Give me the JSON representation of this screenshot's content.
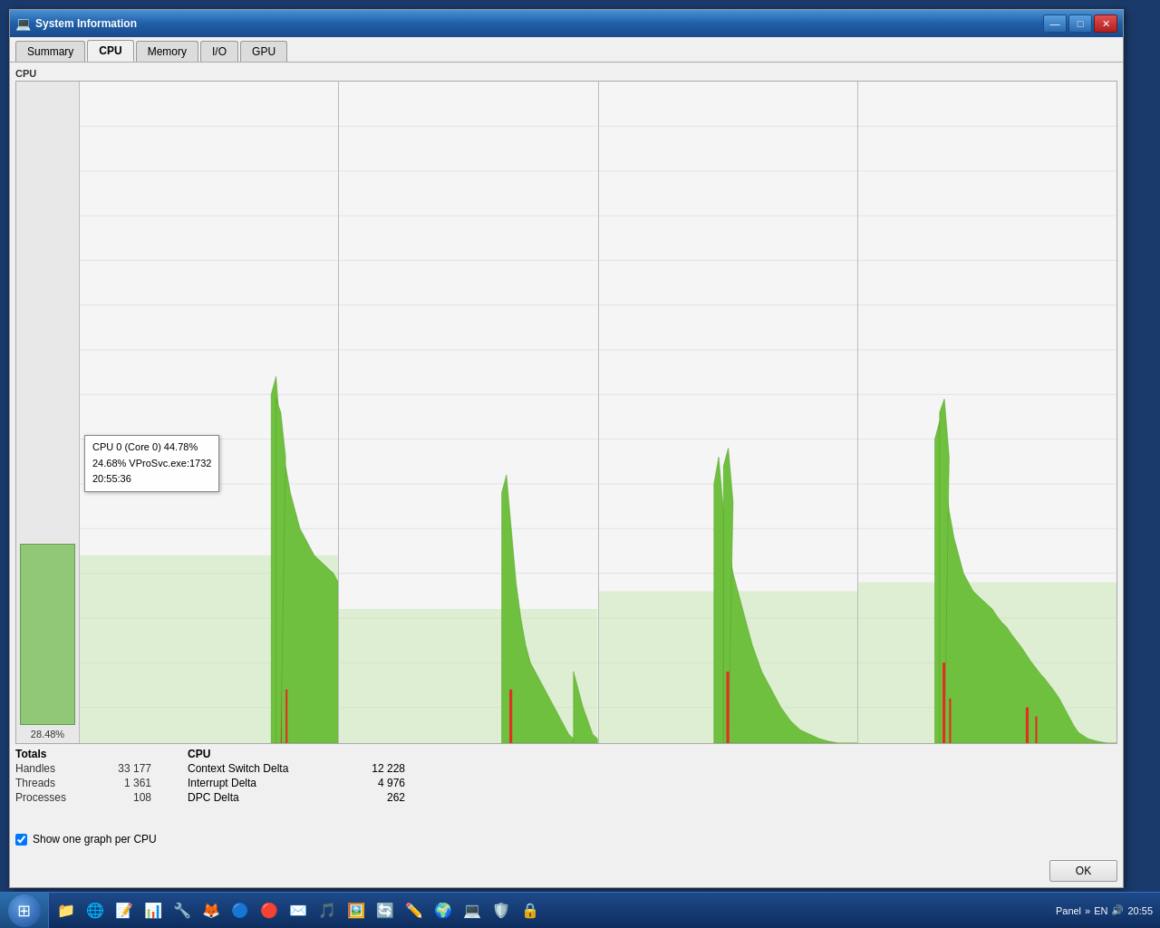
{
  "window": {
    "title": "System Information",
    "icon": "💻"
  },
  "titlebar": {
    "minimize": "—",
    "maximize": "□",
    "close": "✕"
  },
  "tabs": [
    {
      "id": "summary",
      "label": "Summary",
      "active": false
    },
    {
      "id": "cpu",
      "label": "CPU",
      "active": true
    },
    {
      "id": "memory",
      "label": "Memory",
      "active": false
    },
    {
      "id": "io",
      "label": "I/O",
      "active": false
    },
    {
      "id": "gpu",
      "label": "GPU",
      "active": false
    }
  ],
  "section_label": "CPU",
  "y_axis_value": "28.48%",
  "tooltip": {
    "line1": "CPU 0 (Core 0) 44.78%",
    "line2": "24.68% VProSvc.exe:1732",
    "line3": "20:55:36"
  },
  "totals": {
    "title": "Totals",
    "rows": [
      {
        "key": "Handles",
        "value": "33 177"
      },
      {
        "key": "Threads",
        "value": "1 361"
      },
      {
        "key": "Processes",
        "value": "108"
      }
    ]
  },
  "cpu_stats": {
    "title": "CPU",
    "rows": [
      {
        "key": "Context Switch Delta",
        "value": "12 228"
      },
      {
        "key": "Interrupt Delta",
        "value": "4 976"
      },
      {
        "key": "DPC Delta",
        "value": "262"
      }
    ]
  },
  "checkbox": {
    "label": "Show one graph per CPU",
    "checked": true
  },
  "ok_button": "OK",
  "taskbar": {
    "time": "20:55",
    "panel_label": "Panel",
    "en_label": "EN"
  }
}
